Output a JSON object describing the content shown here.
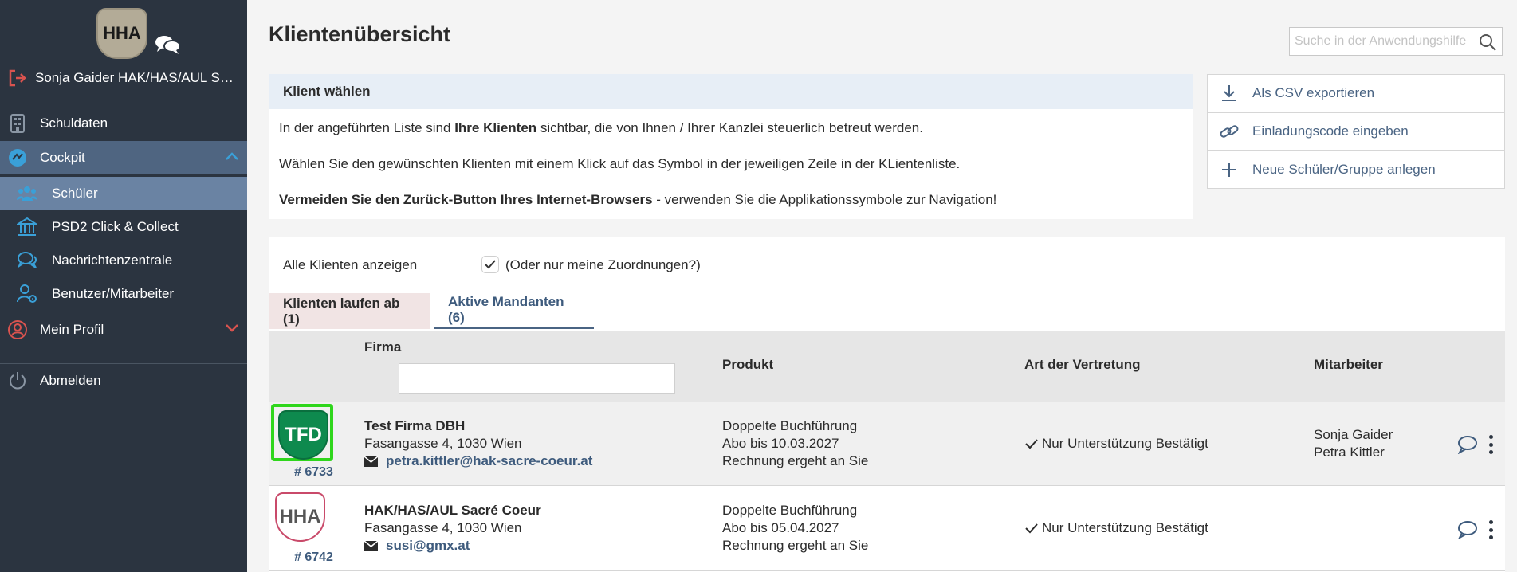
{
  "app": {
    "logo_text": "HHA",
    "user_name": "Sonja Gaider HAK/HAS/AUL Sac..."
  },
  "sidebar": {
    "items": [
      {
        "label": "Schuldaten",
        "icon": "building-icon"
      },
      {
        "label": "Cockpit",
        "icon": "dashboard-icon"
      },
      {
        "label": "Schüler",
        "icon": "users-icon"
      },
      {
        "label": "PSD2 Click & Collect",
        "icon": "bank-icon"
      },
      {
        "label": "Nachrichtenzentrale",
        "icon": "chat-icon"
      },
      {
        "label": "Benutzer/Mitarbeiter",
        "icon": "user-gear-icon"
      },
      {
        "label": "Mein Profil",
        "icon": "profile-icon"
      },
      {
        "label": "Abmelden",
        "icon": "power-icon"
      }
    ]
  },
  "header": {
    "title": "Klientenübersicht",
    "search_placeholder": "Suche in der Anwendungshilfe"
  },
  "info": {
    "header": "Klient wählen",
    "line1_pre": "In der angeführten Liste sind ",
    "line1_bold": "Ihre Klienten",
    "line1_post": " sichtbar, die von Ihnen / Ihrer Kanzlei steuerlich betreut werden.",
    "line2": "Wählen Sie den gewünschten Klienten mit einem Klick auf das Symbol in der jeweiligen Zeile in der KLientenliste.",
    "line3_bold": "Vermeiden Sie den Zurück-Button Ihres Internet-Browsers",
    "line3_post": " - verwenden Sie die Applikationssymbole zur Navigation!"
  },
  "actions": [
    {
      "label": "Als CSV exportieren",
      "icon": "download-icon"
    },
    {
      "label": "Einladungscode eingeben",
      "icon": "link-icon"
    },
    {
      "label": "Neue Schüler/Gruppe anlegen",
      "icon": "plus-icon"
    }
  ],
  "filter": {
    "label": "Alle Klienten anzeigen",
    "checkbox_label": "(Oder nur meine Zuordnungen?)",
    "checked": true
  },
  "tabs": [
    {
      "label": "Klienten laufen ab (1)"
    },
    {
      "label": "Aktive Mandanten (6)"
    }
  ],
  "table": {
    "headers": [
      "Firma",
      "Produkt",
      "Art der Vertretung",
      "Mitarbeiter"
    ],
    "rows": [
      {
        "logo": "TFD",
        "number": "# 6733",
        "name": "Test Firma DBH",
        "address": "Fasangasse 4, 1030 Wien",
        "email": "petra.kittler@hak-sacre-coeur.at",
        "product": [
          "Doppelte Buchführung",
          "Abo bis 10.03.2027",
          "Rechnung ergeht an Sie"
        ],
        "representation": "Nur Unterstützung Bestätigt",
        "staff": [
          "Sonja Gaider",
          "Petra Kittler"
        ]
      },
      {
        "logo": "HHA",
        "number": "# 6742",
        "name": "HAK/HAS/AUL Sacré Coeur",
        "address": "Fasangasse 4, 1030 Wien",
        "email": "susi@gmx.at",
        "product": [
          "Doppelte Buchführung",
          "Abo bis 05.04.2027",
          "Rechnung ergeht an Sie"
        ],
        "representation": "Nur Unterstützung Bestätigt",
        "staff": []
      }
    ]
  },
  "colors": {
    "sidebar_bg": "#2b3440",
    "sidebar_active": "#4f6581",
    "sidebar_selected": "#6a83a3",
    "accent_blue": "#3e5b7d",
    "logout_red": "#d9534f",
    "highlight_green": "#2fd61c",
    "tfd_green": "#0e8a4e"
  }
}
